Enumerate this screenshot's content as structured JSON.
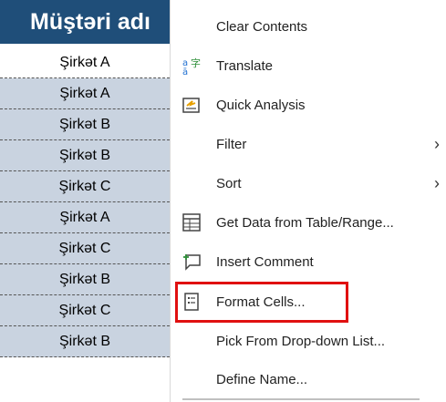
{
  "sheet": {
    "header": "Müştəri adı",
    "rows": [
      {
        "value": "Şirkət A",
        "selected": false
      },
      {
        "value": "Şirkət A",
        "selected": true
      },
      {
        "value": "Şirkət B",
        "selected": true
      },
      {
        "value": "Şirkət B",
        "selected": true
      },
      {
        "value": "Şirkət C",
        "selected": true
      },
      {
        "value": "Şirkət A",
        "selected": true
      },
      {
        "value": "Şirkət C",
        "selected": true
      },
      {
        "value": "Şirkət B",
        "selected": true
      },
      {
        "value": "Şirkət C",
        "selected": true
      },
      {
        "value": "Şirkət B",
        "selected": true
      }
    ]
  },
  "menu": {
    "items": [
      {
        "label": "Clear Contents",
        "icon": "none"
      },
      {
        "label": "Translate",
        "icon": "translate-icon"
      },
      {
        "label": "Quick Analysis",
        "icon": "quick-analysis-icon"
      },
      {
        "label": "Filter",
        "icon": "none",
        "submenu": true
      },
      {
        "label": "Sort",
        "icon": "none",
        "submenu": true
      },
      {
        "label": "Get Data from Table/Range...",
        "icon": "table-icon"
      },
      {
        "label": "Insert Comment",
        "icon": "comment-icon"
      },
      {
        "label": "Format Cells...",
        "icon": "format-cells-icon",
        "highlighted": true
      },
      {
        "label": "Pick From Drop-down List...",
        "icon": "none"
      },
      {
        "label": "Define Name...",
        "icon": "none"
      }
    ],
    "chevron": "›",
    "highlight_color": "#e01010"
  }
}
